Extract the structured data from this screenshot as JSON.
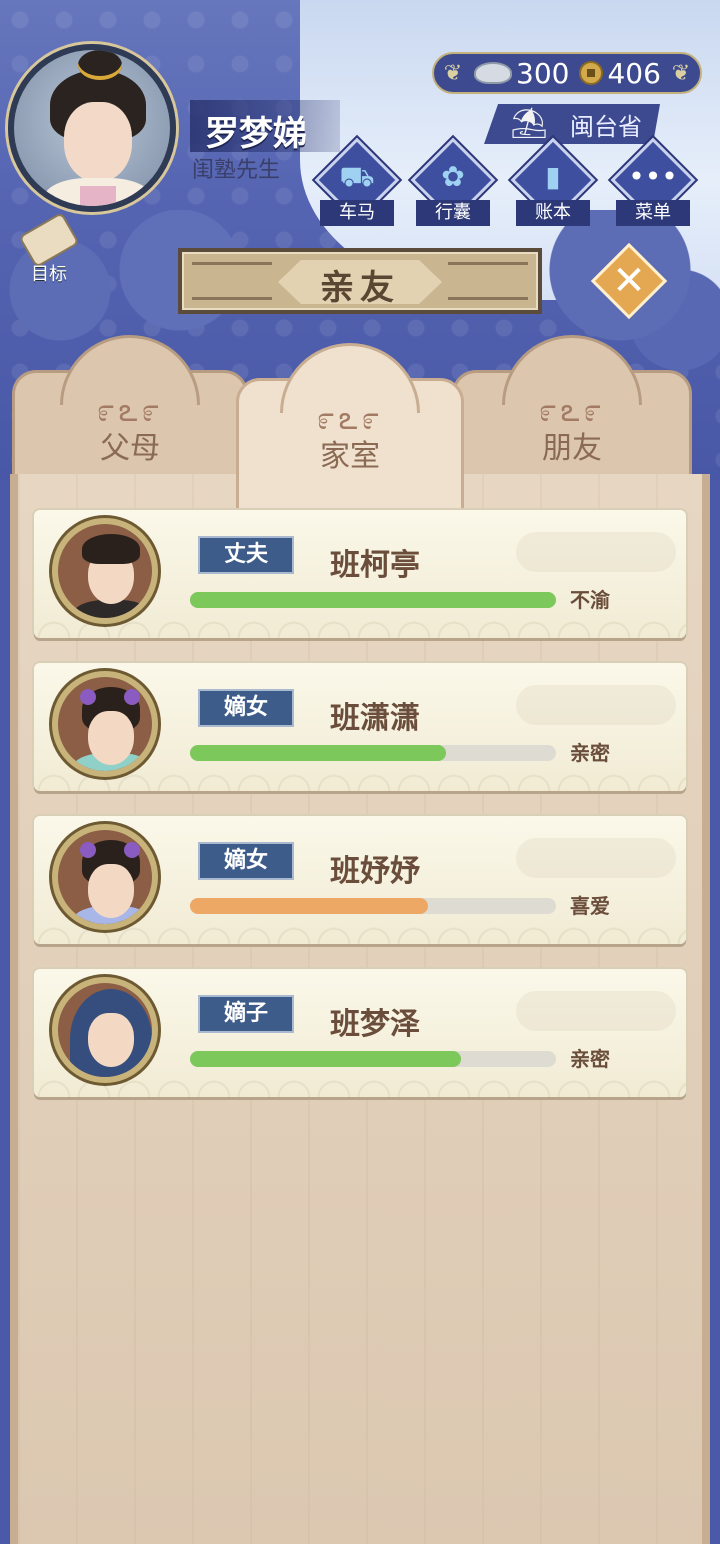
{
  "player": {
    "name": "罗梦娣",
    "title": "闺塾先生"
  },
  "currency": {
    "silver": "300",
    "coins": "406"
  },
  "location": "闽台省",
  "menu": [
    {
      "label": "车马",
      "icon": "carriage-icon"
    },
    {
      "label": "行囊",
      "icon": "bundle-icon"
    },
    {
      "label": "账本",
      "icon": "ledger-icon"
    },
    {
      "label": "菜单",
      "icon": "more-icon"
    }
  ],
  "goal": {
    "label": "目标"
  },
  "banner": {
    "title": "亲友"
  },
  "tabs": [
    {
      "label": "父母",
      "active": false
    },
    {
      "label": "家室",
      "active": true
    },
    {
      "label": "朋友",
      "active": false
    }
  ],
  "members": [
    {
      "role": "丈夫",
      "name": "班柯亭",
      "status": "不渝",
      "affection": 1.0,
      "bar_color": "#7cc85a"
    },
    {
      "role": "嫡女",
      "name": "班潇潇",
      "status": "亲密",
      "affection": 0.7,
      "bar_color": "#7cc85a"
    },
    {
      "role": "嫡女",
      "name": "班妤妤",
      "status": "喜爱",
      "affection": 0.65,
      "bar_color": "#eea866"
    },
    {
      "role": "嫡子",
      "name": "班梦泽",
      "status": "亲密",
      "affection": 0.74,
      "bar_color": "#7cc85a"
    }
  ]
}
